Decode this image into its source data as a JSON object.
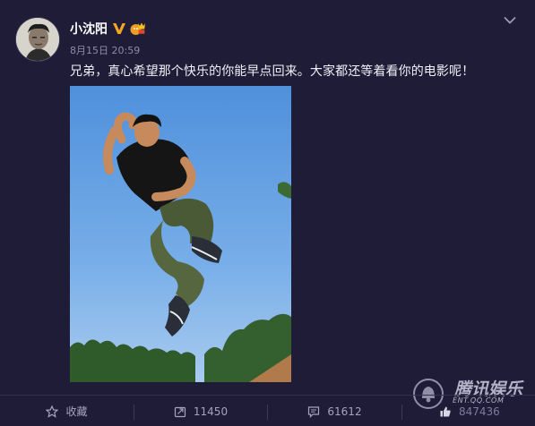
{
  "post": {
    "username": "小沈阳",
    "date": "8月15日 20:59",
    "text": "兄弟，真心希望那个快乐的你能早点回来。大家都还等着看你的电影呢！"
  },
  "actions": {
    "favorite_label": "收藏",
    "repost_count": "11450",
    "comment_count": "61612",
    "like_count": "847436"
  },
  "watermark": {
    "brand": "腾讯娱乐",
    "url": "ENT.QQ.COM"
  },
  "icons": {
    "verified": "verified-v-icon",
    "member": "crown-member-icon",
    "menu": "chevron-down-icon",
    "favorite": "star-icon",
    "repost": "repost-icon",
    "comment": "comment-icon",
    "like": "thumbs-up-icon"
  },
  "colors": {
    "background": "#1f1c38",
    "verified": "#f5a623",
    "member": "#f5a623",
    "sky": "#6fa3e0"
  }
}
